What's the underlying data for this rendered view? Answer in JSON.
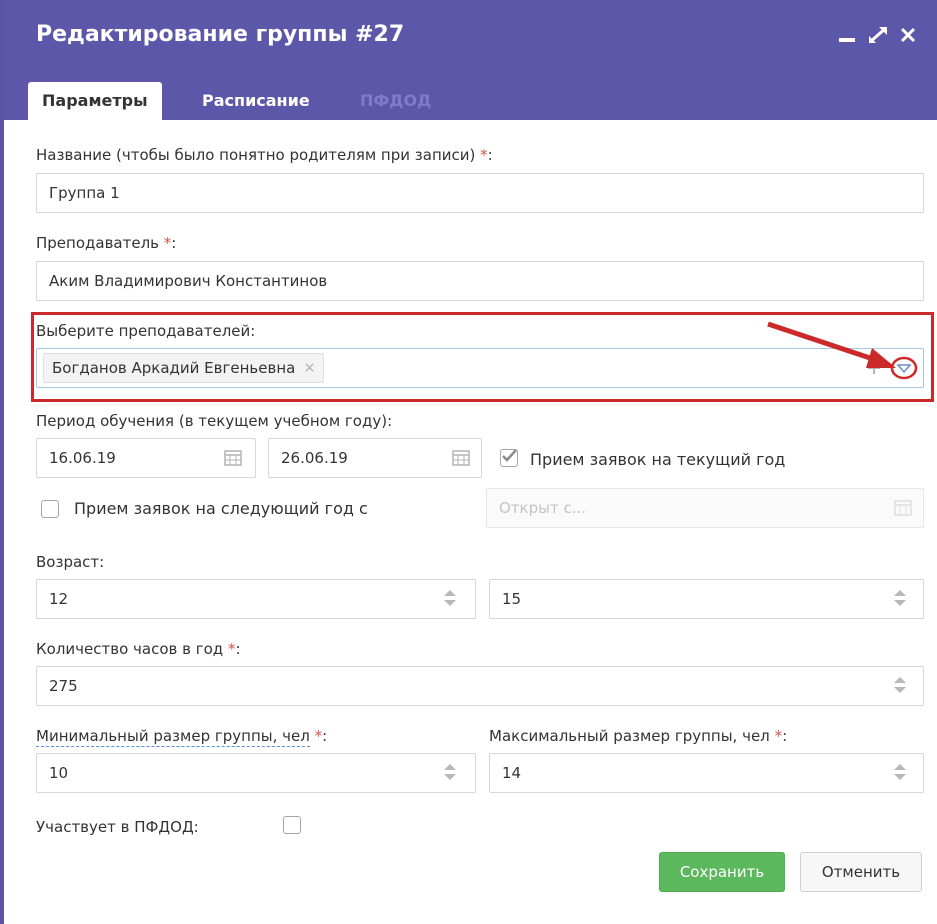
{
  "window": {
    "title": "Редактирование группы #27"
  },
  "tabs": [
    {
      "label": "Параметры"
    },
    {
      "label": "Расписание"
    },
    {
      "label": "ПФДОД"
    }
  ],
  "form": {
    "name": {
      "label": "Название (чтобы было понятно родителям при записи)",
      "required_mark": "*",
      "suffix": ":",
      "value": "Группа 1"
    },
    "teacher": {
      "label": "Преподаватель",
      "required_mark": "*",
      "suffix": ":",
      "value": "Аким Владимирович Константинов"
    },
    "teachers": {
      "label": "Выберите преподавателей:",
      "chips": [
        "Богданов Аркадий Евгеньевна"
      ],
      "chip_remove": "×"
    },
    "period": {
      "label": "Период обучения (в текущем учебном году):",
      "start": "16.06.19",
      "end": "26.06.19"
    },
    "current_year": {
      "label": "Прием заявок на текущий год",
      "checked": true
    },
    "next_year": {
      "label": "Прием заявок на следующий год с",
      "checked": false,
      "placeholder": "Открыт с..."
    },
    "age": {
      "label": "Возраст:",
      "from": "12",
      "to": "15"
    },
    "hours": {
      "label": "Количество часов в год",
      "required_mark": "*",
      "suffix": ":",
      "value": "275"
    },
    "min_size": {
      "label": "Минимальный размер группы, чел",
      "required_mark": "*",
      "suffix": ":",
      "value": "10"
    },
    "max_size": {
      "label": "Максимальный размер группы, чел",
      "required_mark": "*",
      "suffix": ":",
      "value": "14"
    },
    "pfdod": {
      "label": "Участвует в ПФДОД:",
      "checked": false
    }
  },
  "buttons": {
    "save": "Сохранить",
    "cancel": "Отменить"
  },
  "colors": {
    "titlebar": "#5d57aa",
    "required": "#d9534f",
    "save": "#5cb85c",
    "annotation": "#cc2a2a"
  }
}
